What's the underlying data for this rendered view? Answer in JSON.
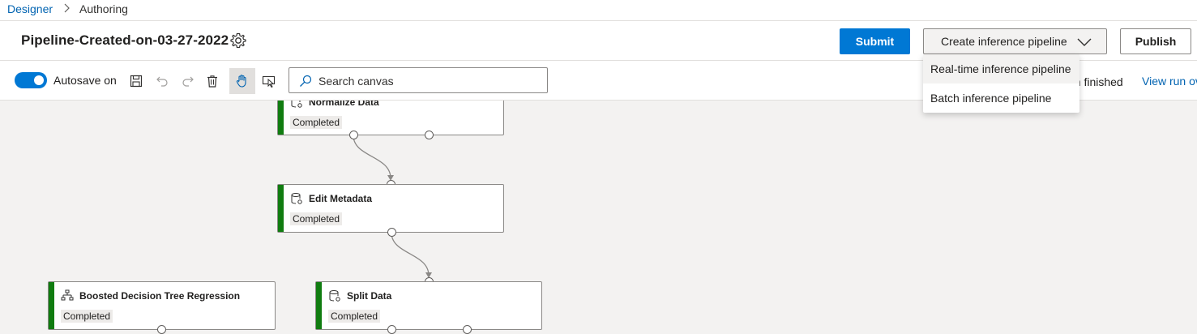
{
  "breadcrumb": {
    "root": "Designer",
    "separator": "›",
    "current": "Authoring"
  },
  "header": {
    "title": "Pipeline-Created-on-03-27-2022",
    "submit_label": "Submit",
    "create_inference_label": "Create inference pipeline",
    "publish_label": "Publish"
  },
  "toolbar": {
    "autosave_label": "Autosave on",
    "autosave_on": true,
    "search_placeholder": "Search canvas",
    "status_text": "un finished",
    "status_link": "View run ov"
  },
  "dropdown": {
    "items": [
      {
        "label": "Real-time inference pipeline"
      },
      {
        "label": "Batch inference pipeline"
      }
    ]
  },
  "canvas": {
    "nodes": [
      {
        "label": "Normalize Data",
        "status": "Completed",
        "icon": "dataset-gear-icon"
      },
      {
        "label": "Edit Metadata",
        "status": "Completed",
        "icon": "dataset-gear-icon"
      },
      {
        "label": "Boosted Decision Tree Regression",
        "status": "Completed",
        "icon": "tree-icon"
      },
      {
        "label": "Split Data",
        "status": "Completed",
        "icon": "dataset-gear-icon"
      }
    ]
  },
  "colors": {
    "primary": "#0078d4",
    "link": "#0063b1",
    "completed_bar": "#107c10",
    "canvas_bg": "#f3f2f1"
  }
}
